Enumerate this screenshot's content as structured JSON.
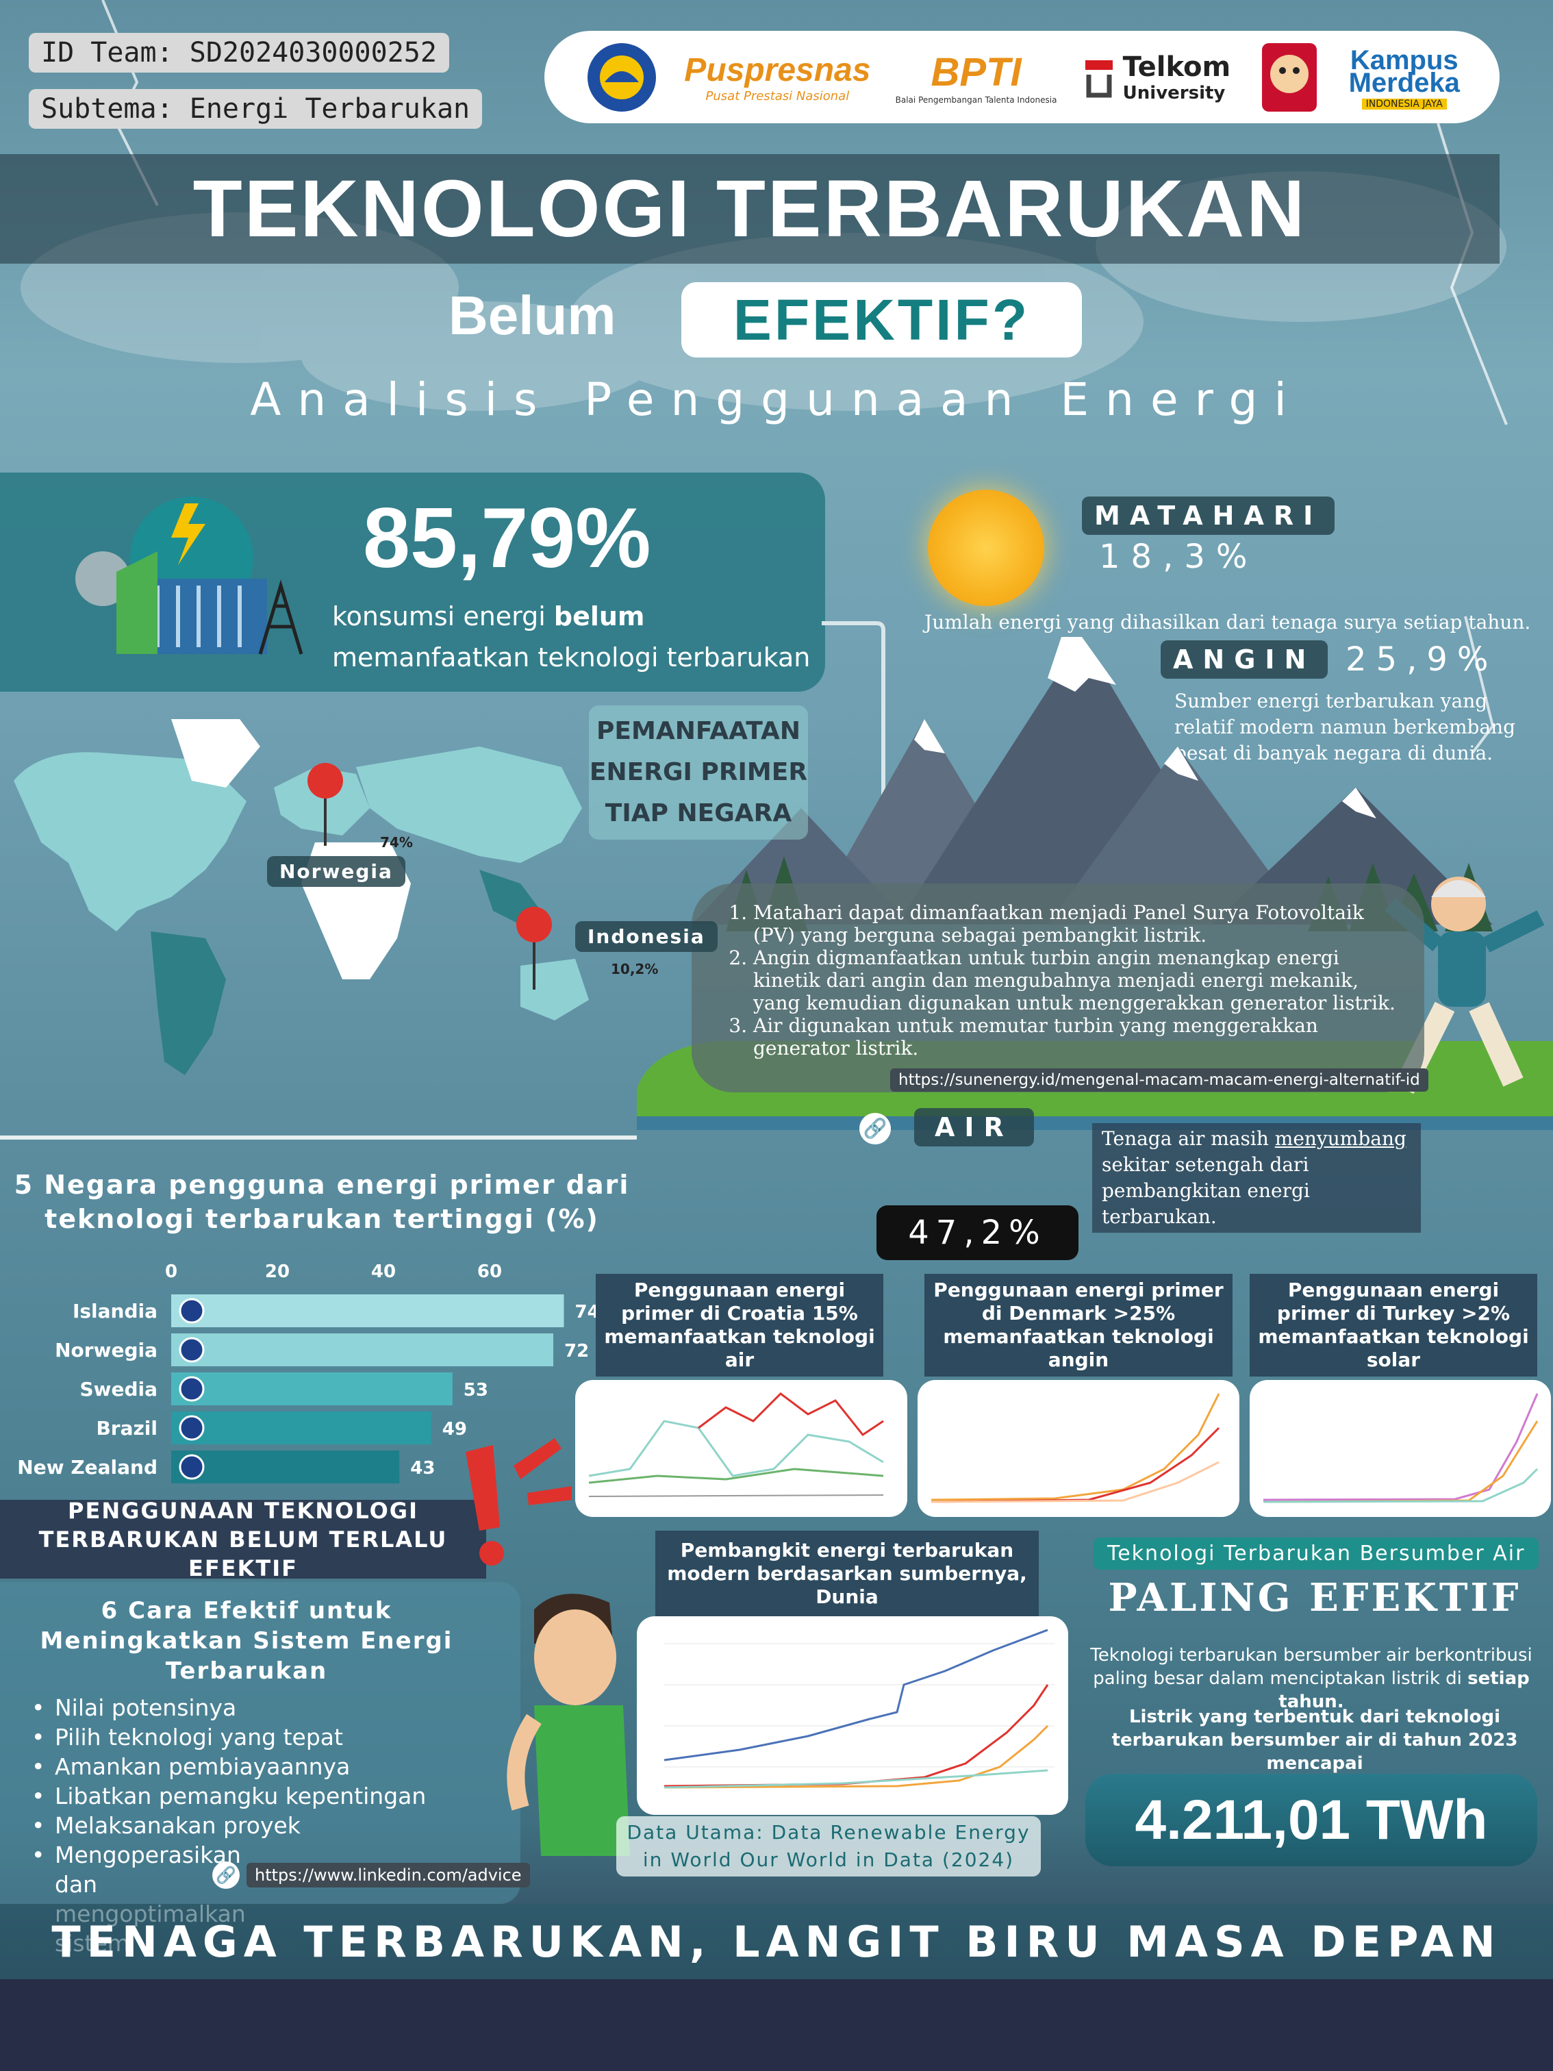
{
  "team": {
    "id_label": "ID Team: SD2024030000252",
    "subtheme_label": "Subtema: Energi Terbarukan"
  },
  "logos": [
    {
      "name": "Puspresnas",
      "sub": "Pusat Prestasi Nasional"
    },
    {
      "name": "BPTI",
      "sub": "Balai Pengembangan Talenta Indonesia"
    },
    {
      "name": "Telkom",
      "sub": "University"
    },
    {
      "name": "Kampus",
      "sub": "Merdeka",
      "tag": "INDONESIA JAYA"
    }
  ],
  "header": {
    "title": "TEKNOLOGI TERBARUKAN",
    "belum": "Belum",
    "efektif": "EFEKTIF?",
    "subtitle": "Analisis Penggunaan Energi"
  },
  "headline_stat": {
    "value": "85,79%",
    "line1_prefix": "konsumsi energi ",
    "line1_bold": "belum",
    "line2": "memanfaatkan teknologi terbarukan"
  },
  "sources": {
    "matahari": {
      "label": "MATAHARI",
      "value": "18,3%",
      "desc": "Jumlah energi yang dihasilkan dari tenaga surya setiap tahun."
    },
    "angin": {
      "label": "ANGIN",
      "value": "25,9%",
      "desc": "Sumber energi terbarukan yang relatif modern namun berkembang pesat di banyak negara di dunia."
    },
    "air": {
      "label": "AIR",
      "value": "47,2%",
      "desc_pre": "Tenaga air masih ",
      "desc_u": "menyumbang",
      "desc_post": " sekitar setengah dari pembangkitan energi terbarukan."
    }
  },
  "map": {
    "heading": [
      "PEMANFAATAN",
      "ENERGI PRIMER",
      "TIAP NEGARA"
    ],
    "norway_label": "Norwegia",
    "norway_value": "74%",
    "indonesia_label": "Indonesia",
    "indonesia_value": "10,2%"
  },
  "explanations": [
    "Matahari dapat dimanfaatkan menjadi Panel Surya Fotovoltaik (PV) yang berguna sebagai pembangkit listrik.",
    "Angin digmanfaatkan untuk turbin angin menangkap energi kinetik dari angin dan mengubahnya menjadi energi mekanik, yang kemudian digunakan untuk menggerakkan generator listrik.",
    "Air digunakan untuk memutar turbin yang menggerakkan generator listrik."
  ],
  "link_sunenergy": "https://sunenergy.id/mengenal-macam-macam-energi-alternatif-id",
  "chart_data": {
    "type": "bar",
    "title": "5 Negara pengguna energi primer dari teknologi terbarukan tertinggi (%)",
    "categories": [
      "Islandia",
      "Norwegia",
      "Swedia",
      "Brazil",
      "New Zealand"
    ],
    "values": [
      74,
      72,
      53,
      49,
      43
    ],
    "ticks": [
      "0",
      "20",
      "40",
      "60"
    ],
    "xlim": [
      0,
      80
    ],
    "colors": [
      "#a5dfe3",
      "#8fd4d9",
      "#4cb6bd",
      "#2a9aa3",
      "#1d7f8a"
    ]
  },
  "country_cards": [
    {
      "title": "Penggunaan energi primer di Croatia 15% memanfaatkan teknologi air"
    },
    {
      "title": "Penggunaan energi primer di Denmark >25% memanfaatkan teknologi angin"
    },
    {
      "title": "Penggunaan energi primer di Turkey >2% memanfaatkan teknologi solar"
    }
  ],
  "effectiveness": {
    "banner": "PENGGUNAAN TEKNOLOGI TERBARUKAN BELUM TERLALU EFEKTIF",
    "tips_title": "6 Cara Efektif untuk Meningkatkan Sistem Energi Terbarukan",
    "tips": [
      "Nilai potensinya",
      "Pilih teknologi yang tepat",
      "Amankan pembiayaannya",
      "Libatkan pemangku kepentingan",
      "Melaksanakan proyek",
      "Mengoperasikan dan mengoptimalkan sistem"
    ],
    "link": "https://www.linkedin.com/advice"
  },
  "world_chart": {
    "title": "Pembangkit energi terbarukan modern berdasarkan sumbernya, Dunia",
    "source": "Data Utama: Data Renewable Energy in World Our World in Data (2024)"
  },
  "water_effective": {
    "label": "Teknologi Terbarukan Bersumber Air",
    "headline": "PALING EFEKTIF",
    "desc_pre": "Teknologi terbarukan bersumber air berkontribusi paling besar dalam menciptakan listrik di ",
    "desc_bold": "setiap tahun.",
    "desc2": "Listrik yang terbentuk dari teknologi terbarukan bersumber air di tahun 2023 mencapai",
    "value": "4.211,01 TWh"
  },
  "footer": "TENAGA TERBARUKAN, LANGIT BIRU MASA DEPAN"
}
